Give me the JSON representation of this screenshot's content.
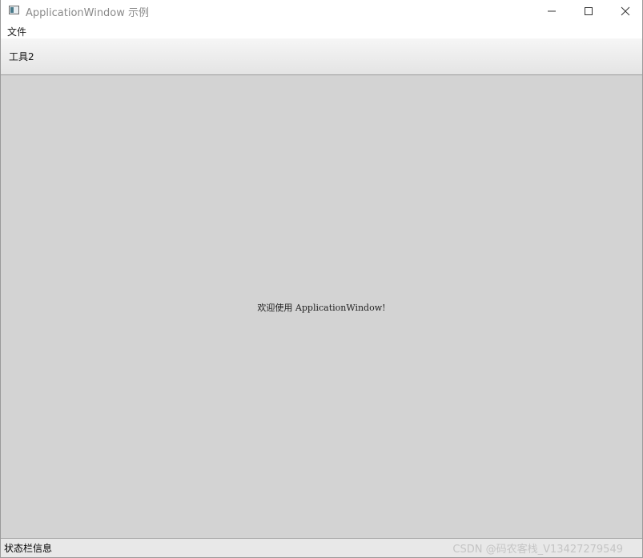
{
  "window": {
    "title": "ApplicationWindow 示例",
    "icon": "app-window-icon"
  },
  "menubar": {
    "items": [
      {
        "label": "文件"
      }
    ]
  },
  "toolbar": {
    "buttons": [
      {
        "label": "工具2"
      }
    ]
  },
  "central": {
    "text": "欢迎使用 ApplicationWindow!",
    "background": "#d3d3d3"
  },
  "statusbar": {
    "text": "状态栏信息",
    "watermark": "CSDN @码农客栈_V13427279549"
  }
}
